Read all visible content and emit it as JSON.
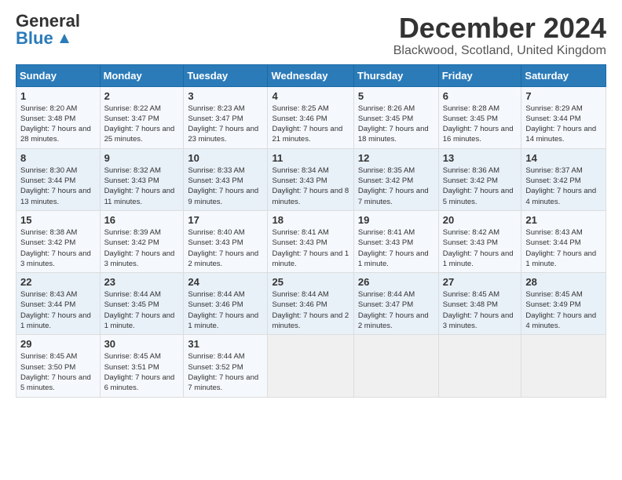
{
  "logo": {
    "general": "General",
    "blue": "Blue"
  },
  "title": {
    "month_year": "December 2024",
    "location": "Blackwood, Scotland, United Kingdom"
  },
  "weekdays": [
    "Sunday",
    "Monday",
    "Tuesday",
    "Wednesday",
    "Thursday",
    "Friday",
    "Saturday"
  ],
  "weeks": [
    [
      {
        "day": "1",
        "sunrise": "Sunrise: 8:20 AM",
        "sunset": "Sunset: 3:48 PM",
        "daylight": "Daylight: 7 hours and 28 minutes."
      },
      {
        "day": "2",
        "sunrise": "Sunrise: 8:22 AM",
        "sunset": "Sunset: 3:47 PM",
        "daylight": "Daylight: 7 hours and 25 minutes."
      },
      {
        "day": "3",
        "sunrise": "Sunrise: 8:23 AM",
        "sunset": "Sunset: 3:47 PM",
        "daylight": "Daylight: 7 hours and 23 minutes."
      },
      {
        "day": "4",
        "sunrise": "Sunrise: 8:25 AM",
        "sunset": "Sunset: 3:46 PM",
        "daylight": "Daylight: 7 hours and 21 minutes."
      },
      {
        "day": "5",
        "sunrise": "Sunrise: 8:26 AM",
        "sunset": "Sunset: 3:45 PM",
        "daylight": "Daylight: 7 hours and 18 minutes."
      },
      {
        "day": "6",
        "sunrise": "Sunrise: 8:28 AM",
        "sunset": "Sunset: 3:45 PM",
        "daylight": "Daylight: 7 hours and 16 minutes."
      },
      {
        "day": "7",
        "sunrise": "Sunrise: 8:29 AM",
        "sunset": "Sunset: 3:44 PM",
        "daylight": "Daylight: 7 hours and 14 minutes."
      }
    ],
    [
      {
        "day": "8",
        "sunrise": "Sunrise: 8:30 AM",
        "sunset": "Sunset: 3:44 PM",
        "daylight": "Daylight: 7 hours and 13 minutes."
      },
      {
        "day": "9",
        "sunrise": "Sunrise: 8:32 AM",
        "sunset": "Sunset: 3:43 PM",
        "daylight": "Daylight: 7 hours and 11 minutes."
      },
      {
        "day": "10",
        "sunrise": "Sunrise: 8:33 AM",
        "sunset": "Sunset: 3:43 PM",
        "daylight": "Daylight: 7 hours and 9 minutes."
      },
      {
        "day": "11",
        "sunrise": "Sunrise: 8:34 AM",
        "sunset": "Sunset: 3:43 PM",
        "daylight": "Daylight: 7 hours and 8 minutes."
      },
      {
        "day": "12",
        "sunrise": "Sunrise: 8:35 AM",
        "sunset": "Sunset: 3:42 PM",
        "daylight": "Daylight: 7 hours and 7 minutes."
      },
      {
        "day": "13",
        "sunrise": "Sunrise: 8:36 AM",
        "sunset": "Sunset: 3:42 PM",
        "daylight": "Daylight: 7 hours and 5 minutes."
      },
      {
        "day": "14",
        "sunrise": "Sunrise: 8:37 AM",
        "sunset": "Sunset: 3:42 PM",
        "daylight": "Daylight: 7 hours and 4 minutes."
      }
    ],
    [
      {
        "day": "15",
        "sunrise": "Sunrise: 8:38 AM",
        "sunset": "Sunset: 3:42 PM",
        "daylight": "Daylight: 7 hours and 3 minutes."
      },
      {
        "day": "16",
        "sunrise": "Sunrise: 8:39 AM",
        "sunset": "Sunset: 3:42 PM",
        "daylight": "Daylight: 7 hours and 3 minutes."
      },
      {
        "day": "17",
        "sunrise": "Sunrise: 8:40 AM",
        "sunset": "Sunset: 3:43 PM",
        "daylight": "Daylight: 7 hours and 2 minutes."
      },
      {
        "day": "18",
        "sunrise": "Sunrise: 8:41 AM",
        "sunset": "Sunset: 3:43 PM",
        "daylight": "Daylight: 7 hours and 1 minute."
      },
      {
        "day": "19",
        "sunrise": "Sunrise: 8:41 AM",
        "sunset": "Sunset: 3:43 PM",
        "daylight": "Daylight: 7 hours and 1 minute."
      },
      {
        "day": "20",
        "sunrise": "Sunrise: 8:42 AM",
        "sunset": "Sunset: 3:43 PM",
        "daylight": "Daylight: 7 hours and 1 minute."
      },
      {
        "day": "21",
        "sunrise": "Sunrise: 8:43 AM",
        "sunset": "Sunset: 3:44 PM",
        "daylight": "Daylight: 7 hours and 1 minute."
      }
    ],
    [
      {
        "day": "22",
        "sunrise": "Sunrise: 8:43 AM",
        "sunset": "Sunset: 3:44 PM",
        "daylight": "Daylight: 7 hours and 1 minute."
      },
      {
        "day": "23",
        "sunrise": "Sunrise: 8:44 AM",
        "sunset": "Sunset: 3:45 PM",
        "daylight": "Daylight: 7 hours and 1 minute."
      },
      {
        "day": "24",
        "sunrise": "Sunrise: 8:44 AM",
        "sunset": "Sunset: 3:46 PM",
        "daylight": "Daylight: 7 hours and 1 minute."
      },
      {
        "day": "25",
        "sunrise": "Sunrise: 8:44 AM",
        "sunset": "Sunset: 3:46 PM",
        "daylight": "Daylight: 7 hours and 2 minutes."
      },
      {
        "day": "26",
        "sunrise": "Sunrise: 8:44 AM",
        "sunset": "Sunset: 3:47 PM",
        "daylight": "Daylight: 7 hours and 2 minutes."
      },
      {
        "day": "27",
        "sunrise": "Sunrise: 8:45 AM",
        "sunset": "Sunset: 3:48 PM",
        "daylight": "Daylight: 7 hours and 3 minutes."
      },
      {
        "day": "28",
        "sunrise": "Sunrise: 8:45 AM",
        "sunset": "Sunset: 3:49 PM",
        "daylight": "Daylight: 7 hours and 4 minutes."
      }
    ],
    [
      {
        "day": "29",
        "sunrise": "Sunrise: 8:45 AM",
        "sunset": "Sunset: 3:50 PM",
        "daylight": "Daylight: 7 hours and 5 minutes."
      },
      {
        "day": "30",
        "sunrise": "Sunrise: 8:45 AM",
        "sunset": "Sunset: 3:51 PM",
        "daylight": "Daylight: 7 hours and 6 minutes."
      },
      {
        "day": "31",
        "sunrise": "Sunrise: 8:44 AM",
        "sunset": "Sunset: 3:52 PM",
        "daylight": "Daylight: 7 hours and 7 minutes."
      },
      null,
      null,
      null,
      null
    ]
  ]
}
